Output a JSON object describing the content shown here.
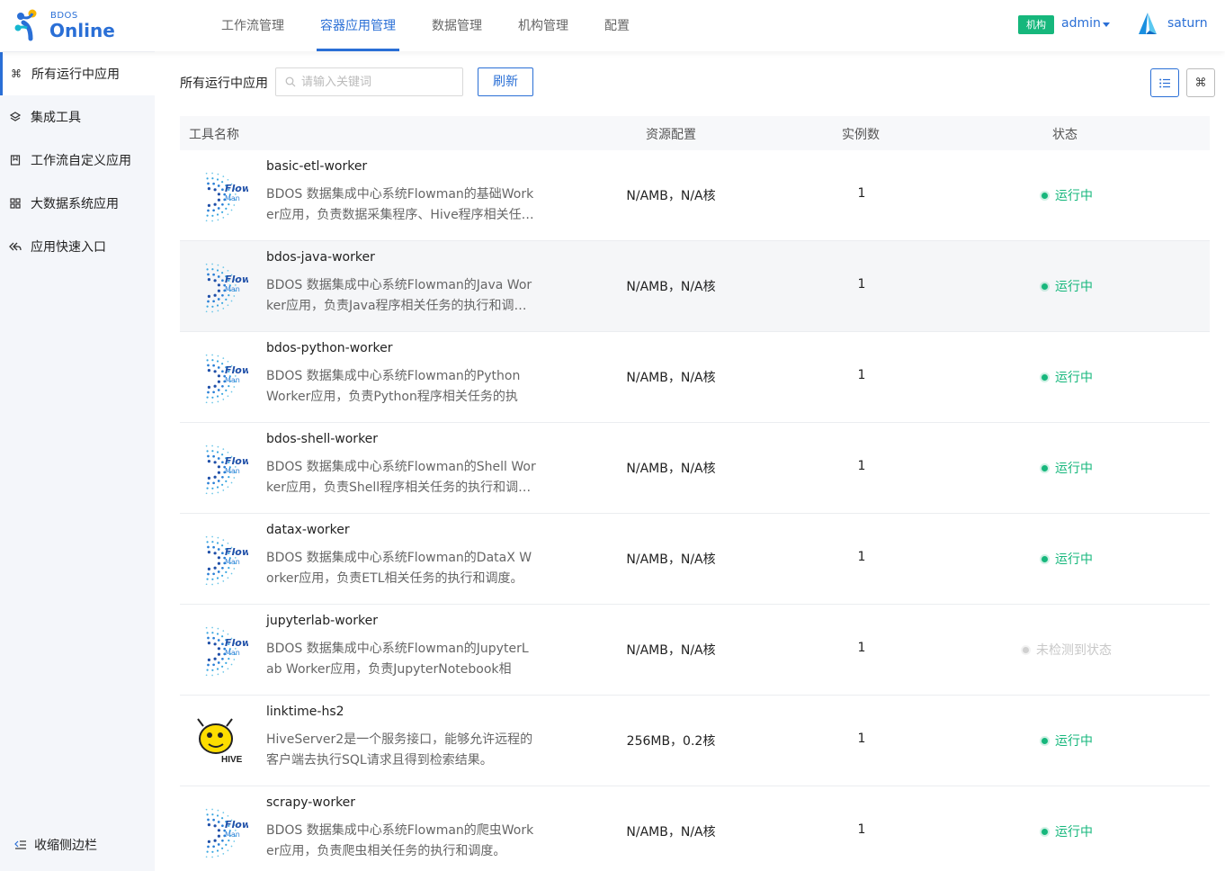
{
  "header": {
    "logo_small": "BDOS",
    "logo_big": "Online",
    "nav": [
      {
        "label": "工作流管理"
      },
      {
        "label": "容器应用管理"
      },
      {
        "label": "数据管理"
      },
      {
        "label": "机构管理"
      },
      {
        "label": "配置"
      }
    ],
    "active_nav": "容器应用管理",
    "org_badge": "机构",
    "user": "admin",
    "tenant": "saturn"
  },
  "sidebar": {
    "items": [
      {
        "label": "所有运行中应用",
        "icon": "command-icon"
      },
      {
        "label": "集成工具",
        "icon": "layers-icon"
      },
      {
        "label": "工作流自定义应用",
        "icon": "bookmark-icon"
      },
      {
        "label": "大数据系统应用",
        "icon": "grid-icon"
      },
      {
        "label": "应用快速入口",
        "icon": "reply-all-icon"
      }
    ],
    "collapse_label": "收缩侧边栏"
  },
  "toolbar": {
    "title": "所有运行中应用",
    "search_placeholder": "请输入关键词",
    "refresh_label": "刷新"
  },
  "table": {
    "columns": [
      "工具名称",
      "资源配置",
      "实例数",
      "状态"
    ],
    "rows": [
      {
        "name": "basic-etl-worker",
        "desc": "BDOS 数据集成中心系统Flowman的基础Worker应用，负责数据采集程序、Hive程序相关任…",
        "resource": "N/AMB，N/A核",
        "instances": "1",
        "status": "运行中",
        "icon": "flowman"
      },
      {
        "name": "bdos-java-worker",
        "desc": "BDOS 数据集成中心系统Flowman的Java Worker应用，负责Java程序相关任务的执行和调…",
        "resource": "N/AMB，N/A核",
        "instances": "1",
        "status": "运行中",
        "icon": "flowman"
      },
      {
        "name": "bdos-python-worker",
        "desc": "BDOS 数据集成中心系统Flowman的Python Worker应用，负责Python程序相关任务的执行…",
        "resource": "N/AMB，N/A核",
        "instances": "1",
        "status": "运行中",
        "icon": "flowman"
      },
      {
        "name": "bdos-shell-worker",
        "desc": "BDOS 数据集成中心系统Flowman的Shell Worker应用，负责Shell程序相关任务的执行和调…",
        "resource": "N/AMB，N/A核",
        "instances": "1",
        "status": "运行中",
        "icon": "flowman"
      },
      {
        "name": "datax-worker",
        "desc": "BDOS 数据集成中心系统Flowman的DataX Worker应用，负责ETL相关任务的执行和调度。",
        "resource": "N/AMB，N/A核",
        "instances": "1",
        "status": "运行中",
        "icon": "flowman"
      },
      {
        "name": "jupyterlab-worker",
        "desc": "BDOS 数据集成中心系统Flowman的JupyterLab Worker应用，负责JupyterNotebook相关…",
        "resource": "N/AMB，N/A核",
        "instances": "1",
        "status": "未检测到状态",
        "icon": "flowman"
      },
      {
        "name": "linktime-hs2",
        "desc": "HiveServer2是一个服务接口，能够允许远程的客户端去执行SQL请求且得到检索结果。",
        "resource": "256MB，0.2核",
        "instances": "1",
        "status": "运行中",
        "icon": "hive"
      },
      {
        "name": "scrapy-worker",
        "desc": "BDOS 数据集成中心系统Flowman的爬虫Worker应用，负责爬虫相关任务的执行和调度。",
        "resource": "N/AMB，N/A核",
        "instances": "1",
        "status": "运行中",
        "icon": "flowman"
      }
    ]
  },
  "icons": {
    "flowman_title": "Flow",
    "flowman_sub": "Man",
    "hive_text": "HIVE"
  },
  "colors": {
    "accent": "#2a6fd6",
    "running": "#16b77c",
    "unknown": "#c8c8c8",
    "sidebar_bg": "#f4f6fa"
  }
}
